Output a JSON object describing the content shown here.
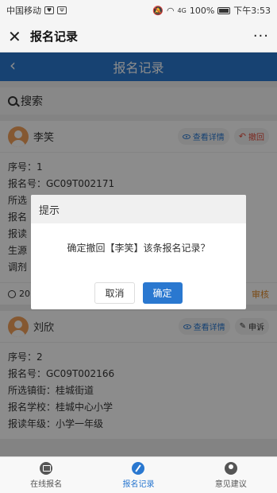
{
  "status": {
    "carrier": "中国移动",
    "battery": "100%",
    "time": "下午3:53",
    "signal": "4G"
  },
  "wx": {
    "close": "✕",
    "title": "报名记录",
    "more": "···"
  },
  "header": {
    "back": "‹",
    "title": "报名记录"
  },
  "search": {
    "label": "搜索"
  },
  "cards": [
    {
      "name": "李笑",
      "view_label": "查看详情",
      "action_label": "撤回",
      "fields": [
        "序号：1",
        "报名号：GC09T002171",
        "所选",
        "报名",
        "报读",
        "生源",
        "调剂"
      ],
      "foot_date": "20",
      "foot_status": "审核"
    },
    {
      "name": "刘欣",
      "view_label": "查看详情",
      "action_label": "申诉",
      "fields": [
        "序号：2",
        "报名号：GC09T002166",
        "所选镇街：桂城街道",
        "报名学校：桂城中心小学",
        "报读年级：小学一年级"
      ]
    }
  ],
  "dialog": {
    "title": "提示",
    "message": "确定撤回【李笑】该条报名记录？",
    "cancel": "取消",
    "ok": "确定"
  },
  "tabs": [
    {
      "label": "在线报名",
      "icon": "monitor-icon"
    },
    {
      "label": "报名记录",
      "icon": "pen-icon"
    },
    {
      "label": "意见建议",
      "icon": "user-icon"
    }
  ],
  "colors": {
    "primary": "#2a78d0",
    "danger": "#e04a3a",
    "avatar": "#f2a05a"
  }
}
